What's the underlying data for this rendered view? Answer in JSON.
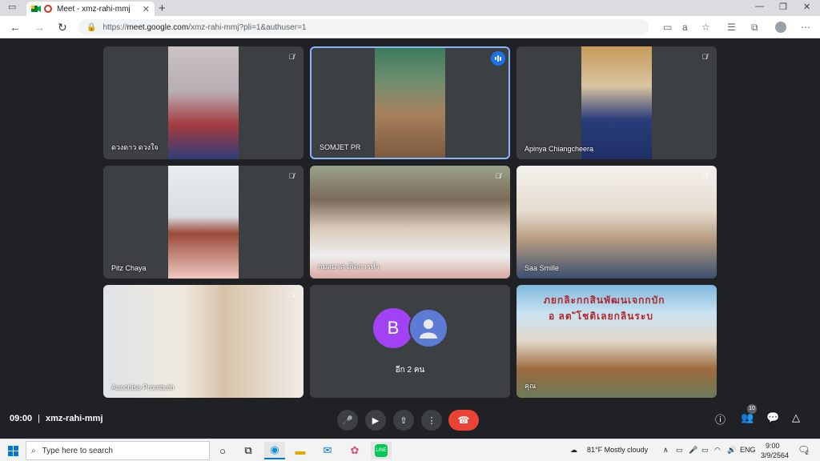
{
  "browser": {
    "tab_title": "Meet - xmz-rahi-mmj",
    "url_prefix": "https://",
    "url_host": "meet.google.com",
    "url_path": "/xmz-rahi-mmj?pli=1&authuser=1"
  },
  "meeting": {
    "time": "09:00",
    "code": "xmz-rahi-mmj",
    "participant_count": "10",
    "others_label": "อีก 2 คน",
    "avatar_letter": "B"
  },
  "participants": [
    {
      "name": "ดวงดาว ดวงใจ"
    },
    {
      "name": "SOMJET PR"
    },
    {
      "name": "Apinya Chiangcheera"
    },
    {
      "name": "Pitz Chaya"
    },
    {
      "name": "กมลมาศ เกิดการทำ"
    },
    {
      "name": "Saa Smille"
    },
    {
      "name": "Aunchisa Prombuth"
    },
    {
      "name": "คุณ"
    }
  ],
  "banner_text": {
    "line1": "ภยกลิะกกสินพัฒนเจกกบัก",
    "line2": "อ ลต ัโชติเลยกลินระบ"
  },
  "taskbar": {
    "search_placeholder": "Type here to search",
    "weather": "81°F  Mostly cloudy",
    "lang": "ENG",
    "time": "9:00",
    "date": "3/9/2564",
    "notif_count": "2"
  },
  "colors": {
    "meet_bg": "#202124",
    "tile_bg": "#3c4043",
    "hangup": "#ea4335",
    "active_border": "#8ab4f8",
    "avatar_purple": "#a142f4",
    "avatar_blue": "#5b7bd5"
  }
}
